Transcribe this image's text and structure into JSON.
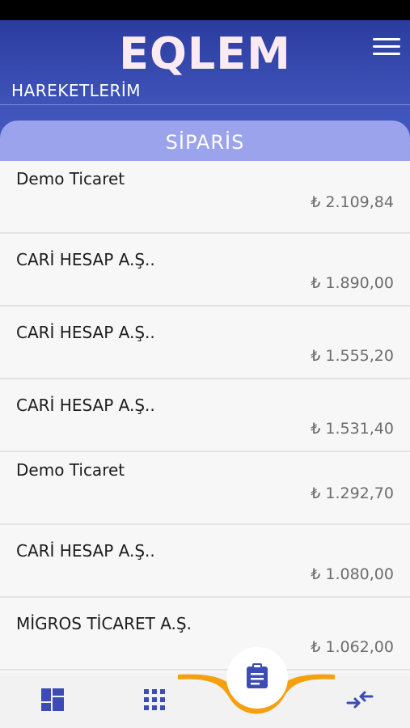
{
  "header": {
    "logo": "EQLEM",
    "title": "HAREKETLERİM"
  },
  "tab": {
    "label": "SİPARİS"
  },
  "orders": [
    {
      "name": "Demo Ticaret",
      "amount": "₺ 2.109,84"
    },
    {
      "name": "CARİ HESAP A.Ş..",
      "amount": "₺ 1.890,00"
    },
    {
      "name": "CARİ HESAP A.Ş..",
      "amount": "₺ 1.555,20"
    },
    {
      "name": "CARİ HESAP A.Ş..",
      "amount": "₺ 1.531,40"
    },
    {
      "name": "Demo Ticaret",
      "amount": "₺ 1.292,70"
    },
    {
      "name": "CARİ HESAP A.Ş..",
      "amount": "₺ 1.080,00"
    },
    {
      "name": "MİGROS TİCARET A.Ş.",
      "amount": "₺ 1.062,00"
    }
  ],
  "colors": {
    "header": "#3d52b8",
    "tab": "#9aa3ec",
    "accent": "#f5a00f",
    "nav_icon": "#3d4cb5"
  },
  "bottom_nav": {
    "items": [
      "dashboard-icon",
      "grid-icon",
      "clipboard-icon",
      "transfer-icon"
    ]
  }
}
